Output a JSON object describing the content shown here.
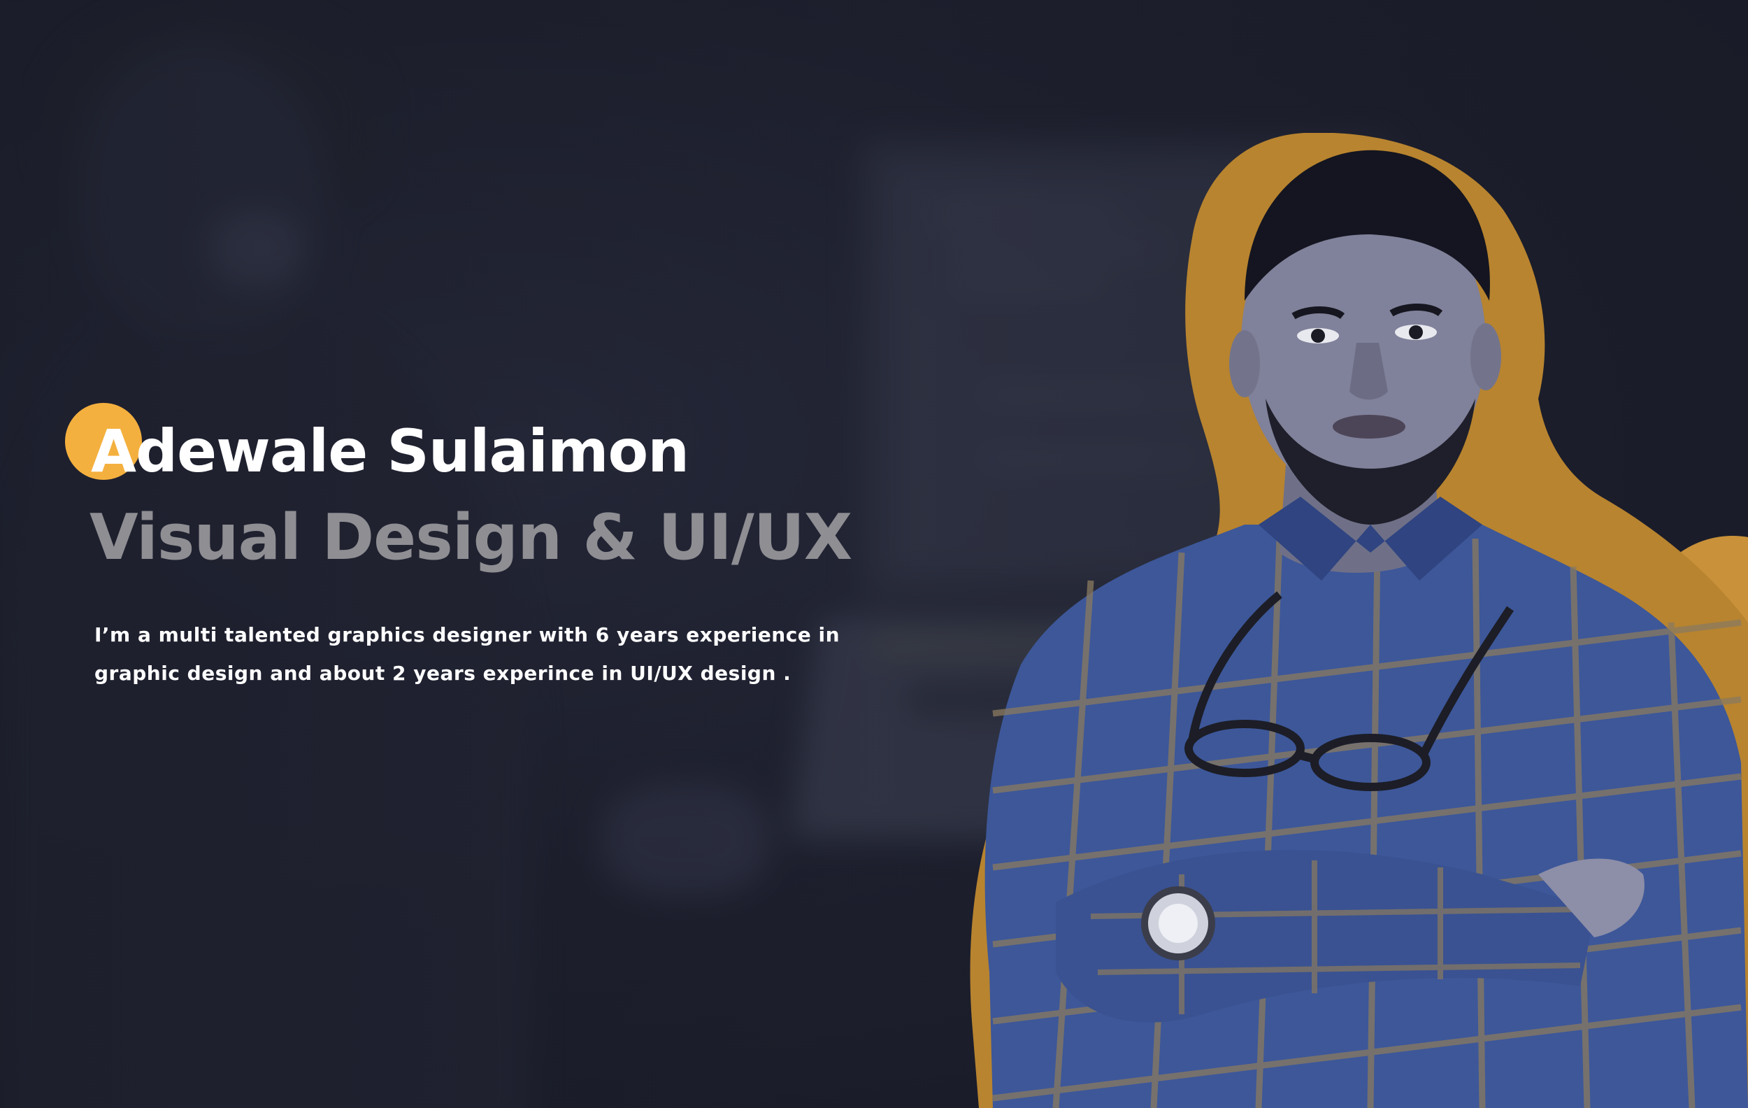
{
  "hero": {
    "name": "Adewale Sulaimon",
    "role": "Visual Design & UI/UX",
    "bio": "I’m a multi talented graphics designer with 6 years experience in graphic design and about 2 years experince in UI/UX design ."
  },
  "colors": {
    "background": "#1a1c29",
    "accent": "#f4b03e",
    "accent_dark": "#c8913a",
    "name_text": "#ffffff",
    "role_text": "#8e8e93",
    "shirt": "#3d5799"
  }
}
